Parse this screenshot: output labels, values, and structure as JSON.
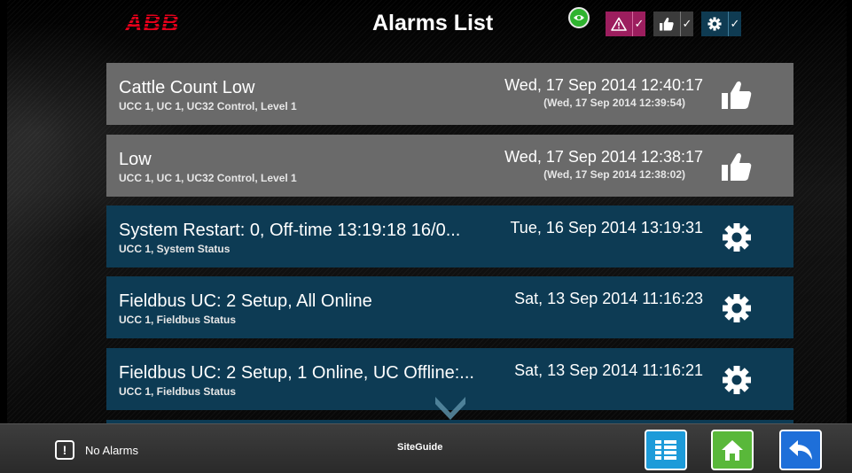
{
  "header": {
    "brand": "ABB",
    "title": "Alarms List",
    "filters": [
      {
        "icon": "warning-icon",
        "check": "✓",
        "color": "#9c1e5e"
      },
      {
        "icon": "thumbs-up-icon",
        "check": "✓",
        "color": "#3b3b3b"
      },
      {
        "icon": "gear-icon",
        "check": "✓",
        "color": "#0f3b52"
      }
    ]
  },
  "alarms": [
    {
      "name": "Cattle Count Low",
      "source": "UCC 1, UC 1, UC32 Control, Level 1",
      "time": "Wed, 17 Sep 2014 12:40:17",
      "original_time": "(Wed, 17 Sep 2014 12:39:54)",
      "action_icon": "thumbs-up-icon",
      "state": "acknowledged"
    },
    {
      "name": "Low",
      "source": "UCC 1, UC 1, UC32 Control, Level 1",
      "time": "Wed, 17 Sep 2014 12:38:17",
      "original_time": "(Wed, 17 Sep 2014 12:38:02)",
      "action_icon": "thumbs-up-icon",
      "state": "acknowledged"
    },
    {
      "name": "System Restart: 0, Off-time 13:19:18 16/0...",
      "source": "UCC 1, System Status",
      "time": "Tue, 16 Sep 2014 13:19:31",
      "action_icon": "gear-icon",
      "state": "system"
    },
    {
      "name": "Fieldbus UC: 2 Setup, All Online",
      "source": "UCC 1, Fieldbus Status",
      "time": "Sat, 13 Sep 2014 11:16:23",
      "action_icon": "gear-icon",
      "state": "system"
    },
    {
      "name": "Fieldbus UC: 2 Setup, 1 Online, UC Offline:...",
      "source": "UCC 1, Fieldbus Status",
      "time": "Sat, 13 Sep 2014 11:16:21",
      "action_icon": "gear-icon",
      "state": "system"
    }
  ],
  "footer": {
    "alarm_indicator": "!",
    "alarm_status": "No Alarms",
    "app_name": "SiteGuide",
    "buttons": [
      "list-icon",
      "home-icon",
      "back-icon"
    ]
  },
  "colors": {
    "acknowledged_row": "#6a6a6a",
    "system_row": "#0d3b54",
    "brand_red": "#e2001a",
    "list_button": "#1d9bd9",
    "home_button": "#59b83a",
    "back_button": "#1e6fd9"
  }
}
